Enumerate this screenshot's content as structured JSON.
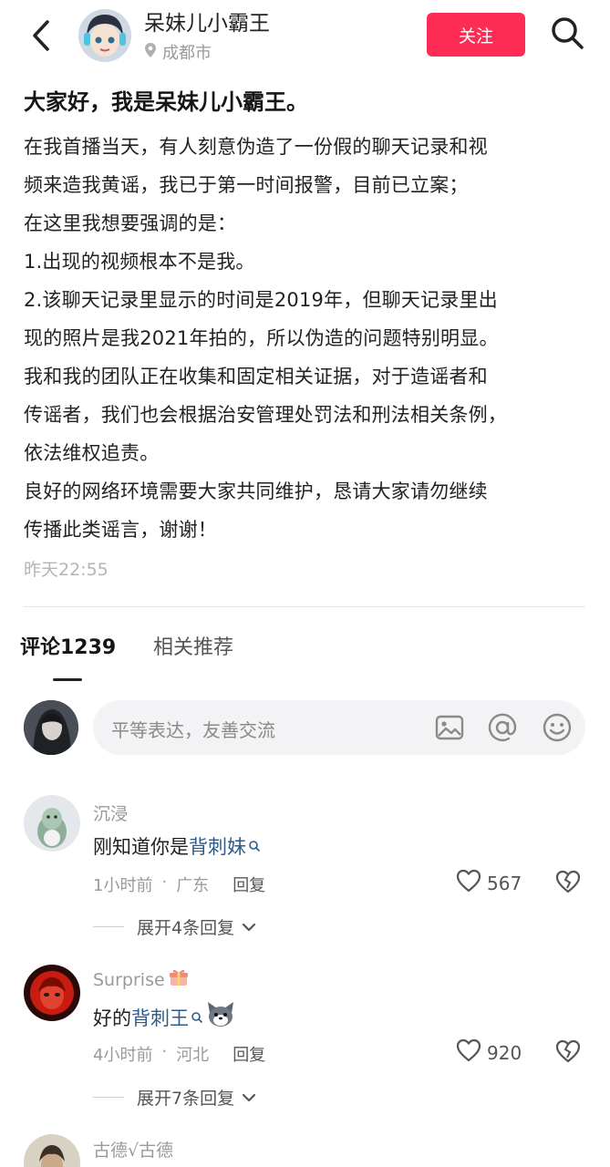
{
  "header": {
    "author_name": "呆妹儿小霸王",
    "location": "成都市",
    "follow_label": "关注"
  },
  "post": {
    "title": "大家好，我是呆妹儿小霸王。",
    "lines": [
      "在我首播当天，有人刻意伪造了一份假的聊天记录和视",
      "频来造我黄谣，我已于第一时间报警，目前已立案；",
      "在这里我想要强调的是：",
      "1.出现的视频根本不是我。",
      "2.该聊天记录里显示的时间是2019年，但聊天记录里出",
      "现的照片是我2021年拍的，所以伪造的问题特别明显。",
      "我和我的团队正在收集和固定相关证据，对于造谣者和",
      "传谣者，我们也会根据治安管理处罚法和刑法相关条例，",
      "依法维权追责。",
      "良好的网络环境需要大家共同维护，恳请大家请勿继续",
      "传播此类谣言，谢谢！"
    ],
    "time": "昨天22:55"
  },
  "tabs": {
    "comments": "评论1239",
    "related": "相关推荐"
  },
  "comment_input": {
    "placeholder": "平等表达，友善交流"
  },
  "comments": [
    {
      "user": "沉浸",
      "text_prefix": "刚知道你是",
      "text_link": "背刺妹",
      "time": "1小时前",
      "region": "广东",
      "reply_label": "回复",
      "likes": "567",
      "expand": "展开4条回复"
    },
    {
      "user": "Surprise",
      "text_prefix": "好的",
      "text_link": "背刺王",
      "time": "4小时前",
      "region": "河北",
      "reply_label": "回复",
      "likes": "920",
      "expand": "展开7条回复"
    },
    {
      "user": "古德√古德"
    }
  ],
  "colors": {
    "follow_bg": "#fe2c55",
    "link": "#2a5b8c",
    "muted": "#9a9a9a"
  }
}
